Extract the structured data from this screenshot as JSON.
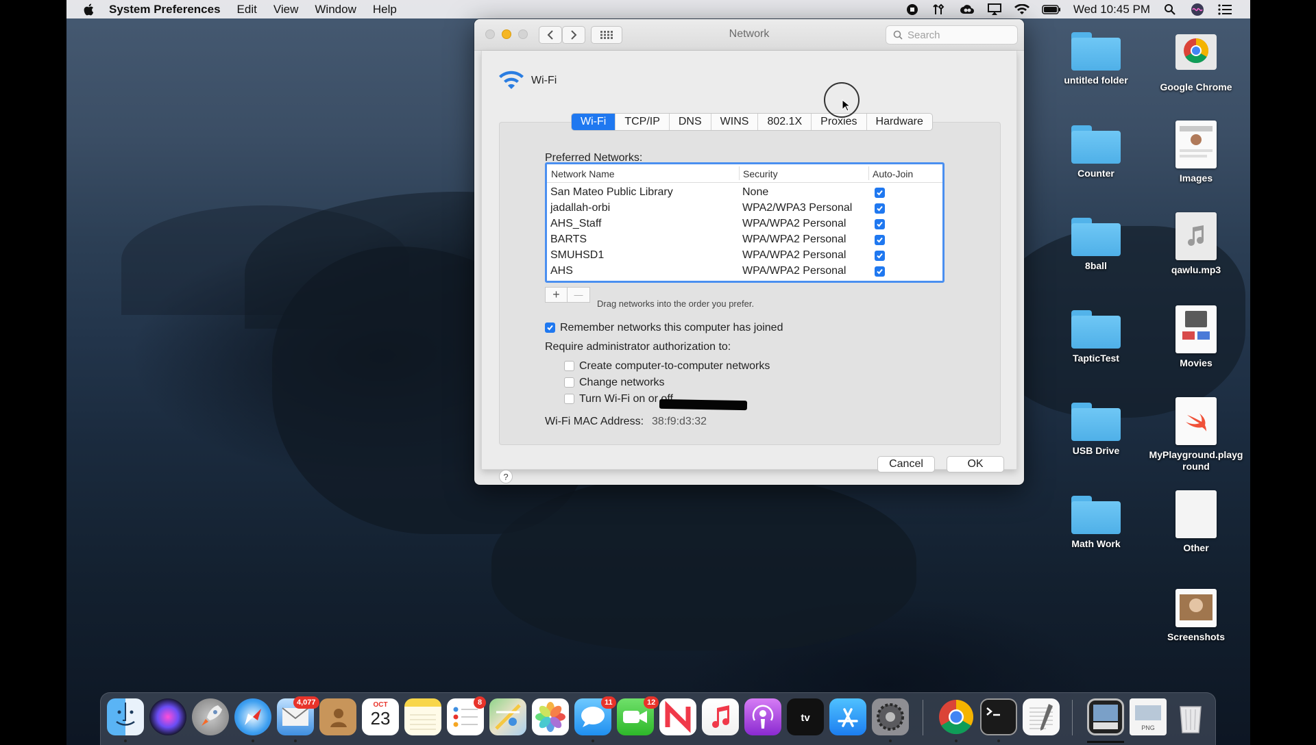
{
  "menubar": {
    "app_name": "System Preferences",
    "menus": [
      "Edit",
      "View",
      "Window",
      "Help"
    ],
    "clock": "Wed 10:45 PM",
    "status_icons": [
      "screen-record-icon",
      "tools-icon",
      "creative-cloud-icon",
      "airplay-icon",
      "wifi-icon",
      "battery-icon",
      "spotlight-icon",
      "siri-icon",
      "notification-center-icon"
    ]
  },
  "window": {
    "title": "Network",
    "search_placeholder": "Search",
    "interface_name": "Wi-Fi",
    "tabs": [
      {
        "label": "Wi-Fi",
        "active": true
      },
      {
        "label": "TCP/IP",
        "active": false
      },
      {
        "label": "DNS",
        "active": false
      },
      {
        "label": "WINS",
        "active": false
      },
      {
        "label": "802.1X",
        "active": false
      },
      {
        "label": "Proxies",
        "active": false
      },
      {
        "label": "Hardware",
        "active": false
      }
    ],
    "preferred_networks_label": "Preferred Networks:",
    "table": {
      "columns": [
        "Network Name",
        "Security",
        "Auto-Join"
      ],
      "rows": [
        {
          "name": "San Mateo Public Library",
          "security": "None",
          "auto_join": true
        },
        {
          "name": "jadallah-orbi",
          "security": "WPA2/WPA3 Personal",
          "auto_join": true
        },
        {
          "name": "AHS_Staff",
          "security": "WPA/WPA2 Personal",
          "auto_join": true
        },
        {
          "name": "BARTS",
          "security": "WPA/WPA2 Personal",
          "auto_join": true
        },
        {
          "name": "SMUHSD1",
          "security": "WPA/WPA2 Personal",
          "auto_join": true
        },
        {
          "name": "AHS",
          "security": "WPA/WPA2 Personal",
          "auto_join": true
        }
      ]
    },
    "add_label": "+",
    "remove_label": "—",
    "drag_hint": "Drag networks into the order you prefer.",
    "remember_networks": {
      "label": "Remember networks this computer has joined",
      "checked": true
    },
    "require_admin_label": "Require administrator authorization to:",
    "admin_options": [
      {
        "label": "Create computer-to-computer networks",
        "checked": false
      },
      {
        "label": "Change networks",
        "checked": false
      },
      {
        "label": "Turn Wi-Fi on or off",
        "checked": false
      }
    ],
    "mac_label": "Wi-Fi MAC Address:",
    "mac_value": "38:f9:d3:32",
    "help_label": "?",
    "cancel_label": "Cancel",
    "ok_label": "OK"
  },
  "desktop_icons": [
    {
      "name": "untitled folder",
      "kind": "folder"
    },
    {
      "name": "Google Chrome",
      "kind": "app"
    },
    {
      "name": "Counter",
      "kind": "folder"
    },
    {
      "name": "Images",
      "kind": "document"
    },
    {
      "name": "8ball",
      "kind": "folder"
    },
    {
      "name": "qawlu.mp3",
      "kind": "audio"
    },
    {
      "name": "TapticTest",
      "kind": "folder"
    },
    {
      "name": "Movies",
      "kind": "document"
    },
    {
      "name": "USB Drive",
      "kind": "folder"
    },
    {
      "name": "MyPlayground.playground",
      "kind": "playground"
    },
    {
      "name": "Math Work",
      "kind": "folder"
    },
    {
      "name": "Other",
      "kind": "document"
    },
    {
      "name": "Screenshots",
      "kind": "document"
    }
  ],
  "dock": {
    "items": [
      "Finder",
      "Siri",
      "Launchpad",
      "Safari",
      "Mail",
      "Contacts",
      "Calendar",
      "Notes",
      "Reminders",
      "Maps",
      "Photos",
      "Messages",
      "FaceTime",
      "News",
      "Music",
      "Podcasts",
      "TV",
      "App Store",
      "System Preferences",
      "Google Chrome",
      "Terminal",
      "TextEdit",
      "Preview",
      "PNG document",
      "Trash"
    ],
    "mail_badge": "4,077",
    "reminders_badge": "8",
    "messages_badge": "11",
    "facetime_badge": "12",
    "calendar_month": "OCT",
    "calendar_day": "23"
  }
}
